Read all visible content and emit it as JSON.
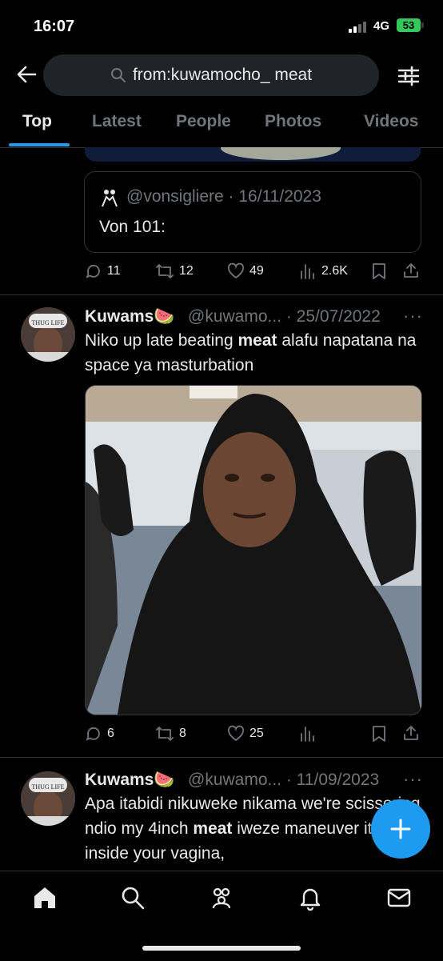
{
  "status_bar": {
    "time": "16:07",
    "network": "4G",
    "battery": "53"
  },
  "header": {
    "search_query": "from:kuwamocho_ meat"
  },
  "tabs": [
    {
      "label": "Top",
      "active": true
    },
    {
      "label": "Latest",
      "active": false
    },
    {
      "label": "People",
      "active": false
    },
    {
      "label": "Photos",
      "active": false
    },
    {
      "label": "Videos",
      "active": false
    }
  ],
  "tweet1": {
    "quote": {
      "user_line": "@vonsigliere · 16/11/2023",
      "text": "Von 101:"
    },
    "actions": {
      "replies": "11",
      "retweets": "12",
      "likes": "49",
      "views": "2.6K"
    }
  },
  "tweet2": {
    "name": "Kuwams🍉",
    "handle_date": "@kuwamo... · 25/07/2022",
    "text_plain_1": "Niko up late beating ",
    "text_bold": "meat",
    "text_plain_2": " alafu napatana na space ya masturbation",
    "actions": {
      "replies": "6",
      "retweets": "8",
      "likes": "25"
    }
  },
  "tweet3": {
    "name": "Kuwams🍉",
    "handle_date": "@kuwamo... · 11/09/2023",
    "text_plain_1": "Apa itabidi nikuweke nikama we're scissoring ndio my 4inch ",
    "text_bold": "meat",
    "text_plain_2": " iweze maneuver it's way inside your vagina,"
  },
  "colors": {
    "accent": "#1d9bf0",
    "muted": "#71767b",
    "divider": "#2f3336",
    "battery": "#34c759"
  },
  "icons": [
    "back-arrow-icon",
    "search-icon",
    "filter-icon",
    "reply-icon",
    "retweet-icon",
    "like-icon",
    "views-icon",
    "bookmark-icon",
    "share-icon",
    "more-icon",
    "compose-icon",
    "home-icon",
    "explore-icon",
    "communities-icon",
    "notifications-icon",
    "messages-icon"
  ]
}
